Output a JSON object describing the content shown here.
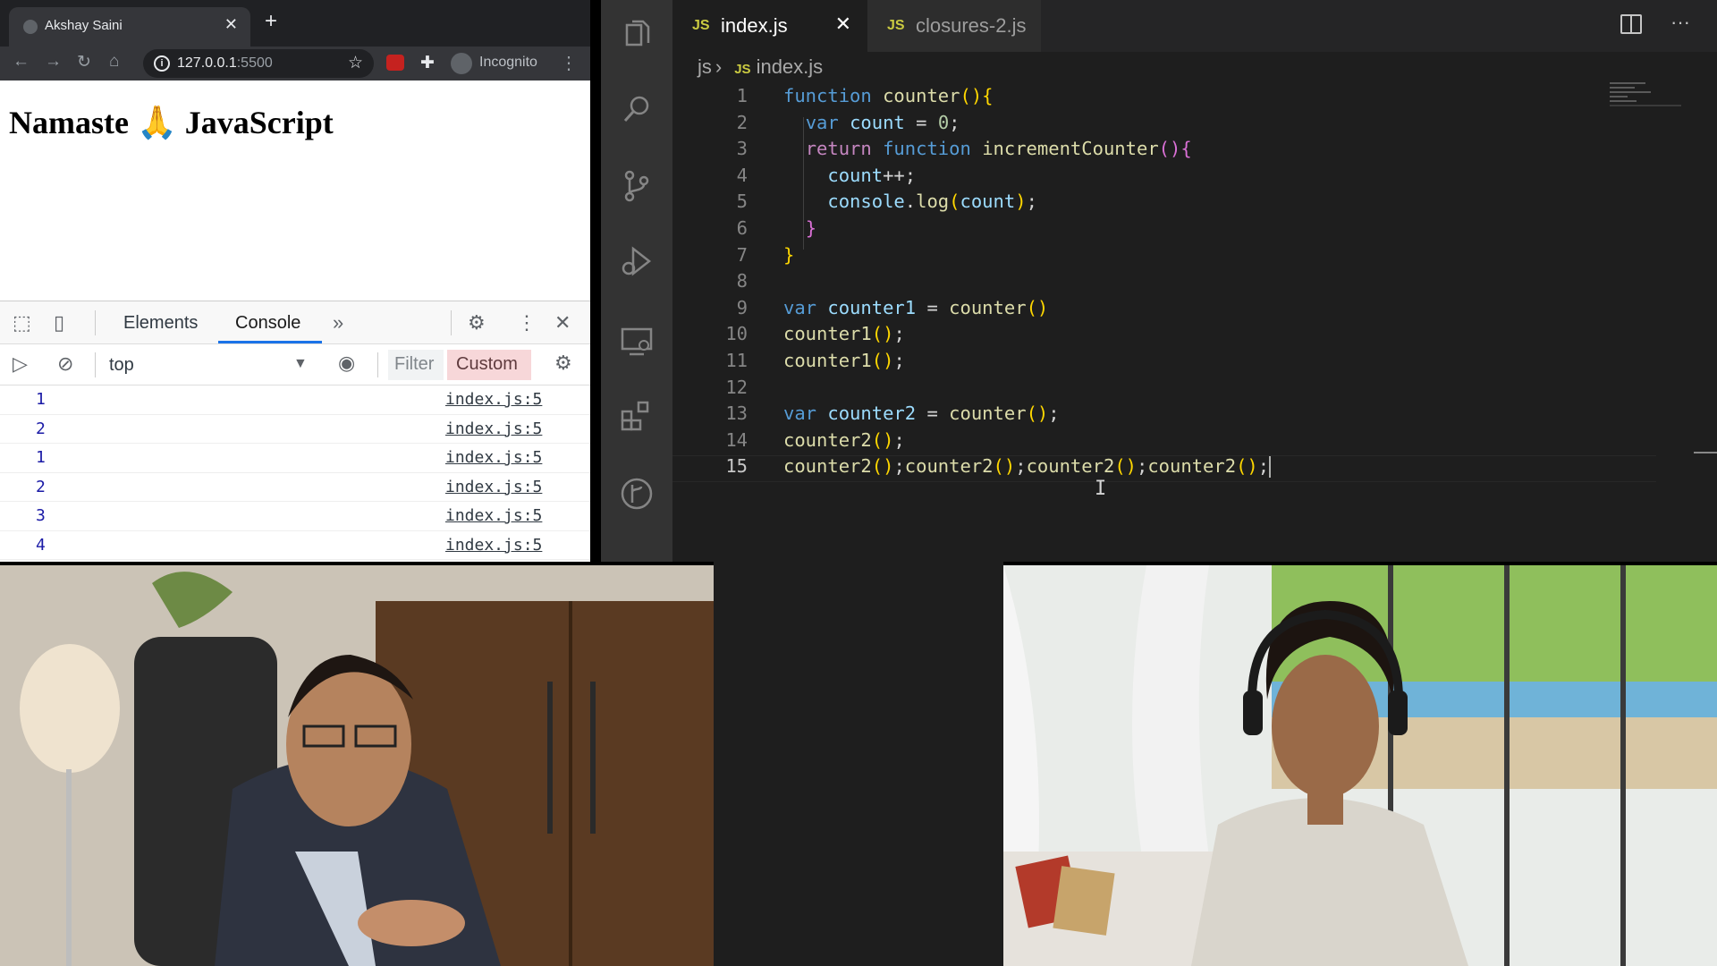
{
  "browser": {
    "tab_title": "Akshay Saini",
    "url_host": "127.0.0.1",
    "url_port": ":5500",
    "incognito_label": "Incognito",
    "page_heading": "Namaste 🙏 JavaScript"
  },
  "devtools": {
    "tabs": [
      "Elements",
      "Console"
    ],
    "active_tab": "Console",
    "context": "top",
    "filter_placeholder": "Filter",
    "levels_label": "Custom",
    "log": [
      {
        "value": "1",
        "source": "index.js:5"
      },
      {
        "value": "2",
        "source": "index.js:5"
      },
      {
        "value": "1",
        "source": "index.js:5"
      },
      {
        "value": "2",
        "source": "index.js:5"
      },
      {
        "value": "3",
        "source": "index.js:5"
      },
      {
        "value": "4",
        "source": "index.js:5"
      }
    ]
  },
  "editor": {
    "tabs": [
      {
        "label": "index.js",
        "active": true
      },
      {
        "label": "closures-2.js",
        "active": false
      }
    ],
    "breadcrumb": {
      "folder": "js",
      "file": "index.js"
    },
    "language_badge": "JS",
    "line_numbers": [
      "1",
      "2",
      "3",
      "4",
      "5",
      "6",
      "7",
      "8",
      "9",
      "10",
      "11",
      "12",
      "13",
      "14",
      "15"
    ],
    "code_lines": [
      "function counter(){",
      "  var count = 0;",
      "  return function incrementCounter(){",
      "    count++;",
      "    console.log(count);",
      "  }",
      "}",
      "",
      "var counter1 = counter()",
      "counter1();",
      "counter1();",
      "",
      "var counter2 = counter();",
      "counter2();",
      "counter2();counter2();counter2();counter2();"
    ]
  },
  "colors": {
    "editor_bg": "#1e1e1e",
    "activity_bg": "#333333",
    "keyword": "#569cd6",
    "control": "#c586c0",
    "function": "#dcdcaa",
    "variable": "#9cdcfe",
    "number": "#b5cea8",
    "console_value": "#1a1aa6",
    "devtools_accent": "#1a73e8"
  }
}
